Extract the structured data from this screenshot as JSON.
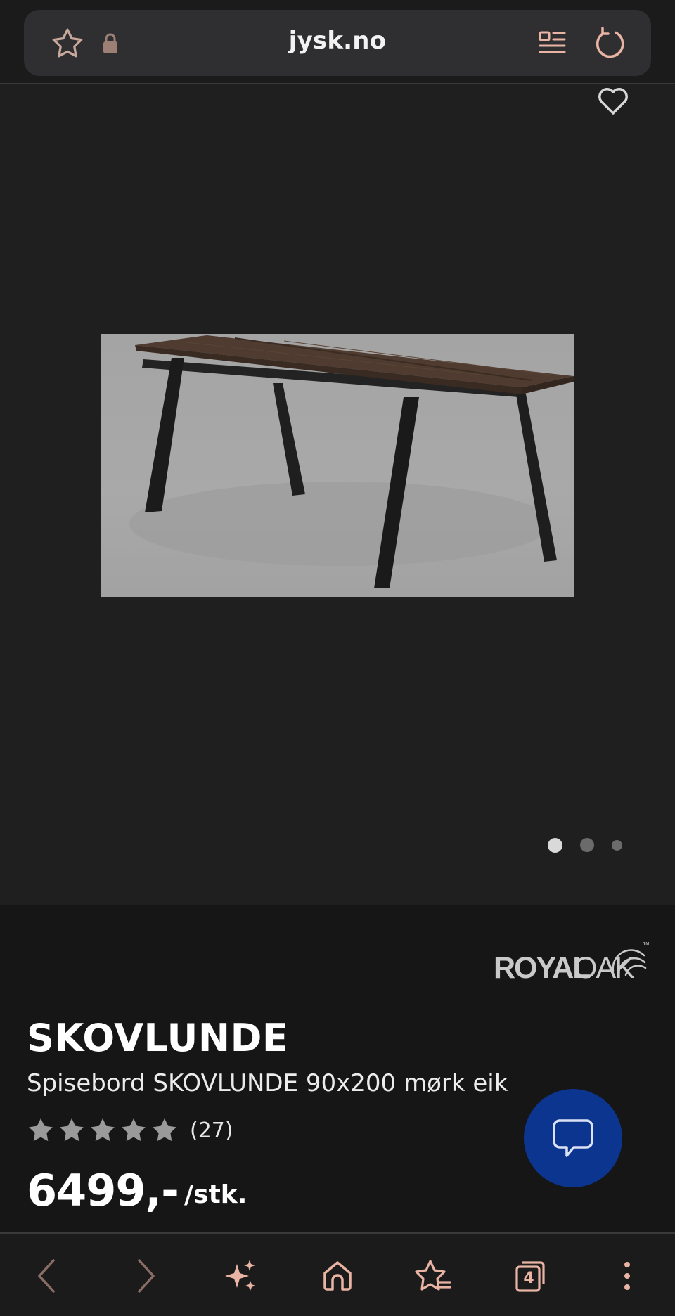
{
  "browser": {
    "url": "jysk.no",
    "accent_color": "#e9b4a4",
    "icons": [
      "star-icon",
      "lock-icon",
      "reader-mode-icon",
      "reload-icon"
    ]
  },
  "gallery": {
    "image_alt": "Spisebord SKOVLUNDE",
    "dots_total": 3,
    "active_dot": 1,
    "favorite_icon": "heart-icon"
  },
  "product": {
    "brand": "ROYALOAK",
    "brand_part1": "ROYAL",
    "brand_part2": "OAK",
    "brand_tm": "™",
    "name": "SKOVLUNDE",
    "description": "Spisebord SKOVLUNDE 90x200 mørk eik",
    "rating": 5,
    "review_count": "(27)",
    "price": "6499,-",
    "unit": "/stk."
  },
  "chat": {
    "icon": "chat-bubble-icon",
    "color": "#0c3590"
  },
  "bottom_nav": {
    "tab_count": "4",
    "items": [
      "back",
      "forward",
      "ai-assistant",
      "home",
      "bookmarks",
      "tabs",
      "menu"
    ]
  }
}
